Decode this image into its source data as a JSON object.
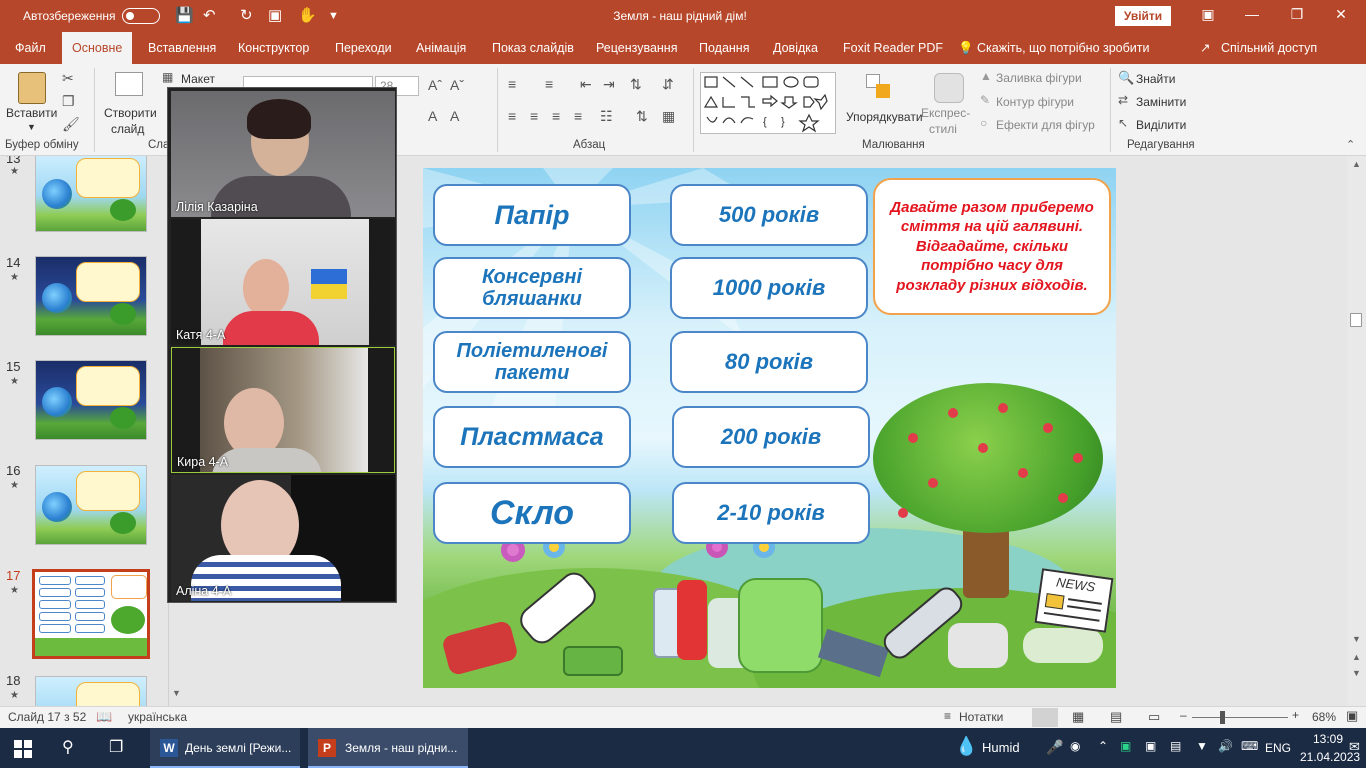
{
  "titlebar": {
    "autosave_label": "Автозбереження",
    "title": "Земля - наш рідний дім!",
    "signin": "Увійти"
  },
  "tabs": [
    "Файл",
    "Основне",
    "Вставлення",
    "Конструктор",
    "Переходи",
    "Анімація",
    "Показ слайдів",
    "Рецензування",
    "Подання",
    "Довідка",
    "Foxit Reader PDF",
    "Скажіть, що потрібно зробити",
    "Спільний доступ"
  ],
  "ribbon": {
    "paste": "Вставити",
    "clipboard_group": "Буфер обміну",
    "new_slide_1": "Створити",
    "new_slide_2": "слайд",
    "layout": "Макет",
    "slides_group_partial": "Сла",
    "font_size": "28",
    "paragraph_group": "Абзац",
    "arrange": "Упорядкувати",
    "quick_styles_1": "Експрес-",
    "quick_styles_2": "стилі",
    "shape_fill": "Заливка фігури",
    "shape_outline": "Контур фігури",
    "shape_effects": "Ефекти для фігур",
    "drawing_group": "Малювання",
    "find": "Знайти",
    "replace": "Замінити",
    "select": "Виділити",
    "editing_group": "Редагування"
  },
  "thumbnails": [
    {
      "num": "13"
    },
    {
      "num": "14"
    },
    {
      "num": "15"
    },
    {
      "num": "16"
    },
    {
      "num": "17"
    },
    {
      "num": "18"
    }
  ],
  "slide": {
    "left_cards": [
      "Папір",
      "Консервні бляшанки",
      "Поліетиленові пакети",
      "Пластмаса",
      "Скло"
    ],
    "right_cards": [
      "500 років",
      "1000 років",
      "80 років",
      "200 років",
      "2-10 років"
    ],
    "note": "Давайте разом приберемо сміття на цій галявині.  Відгадайте, скільки потрібно часу для розкладу різних відходів.",
    "news": "NEWS"
  },
  "video": {
    "participants": [
      "Лілія Казаріна",
      "Катя  4-А",
      "Кира 4-А",
      "Аліна 4-А"
    ]
  },
  "status": {
    "slide_info": "Слайд 17 з 52",
    "language": "українська",
    "notes": "Нотатки",
    "zoom": "68%"
  },
  "taskbar": {
    "app1": "День землі [Режи...",
    "app2": "Земля - наш рідни...",
    "weather": "Humid",
    "lang": "ENG",
    "time": "13:09",
    "date": "21.04.2023"
  },
  "colors": {
    "accent": "#b7472a",
    "card_border": "#4a86c8",
    "card_text": "#1c74bb",
    "note_text": "#e3151e",
    "note_border": "#f2a24a"
  }
}
